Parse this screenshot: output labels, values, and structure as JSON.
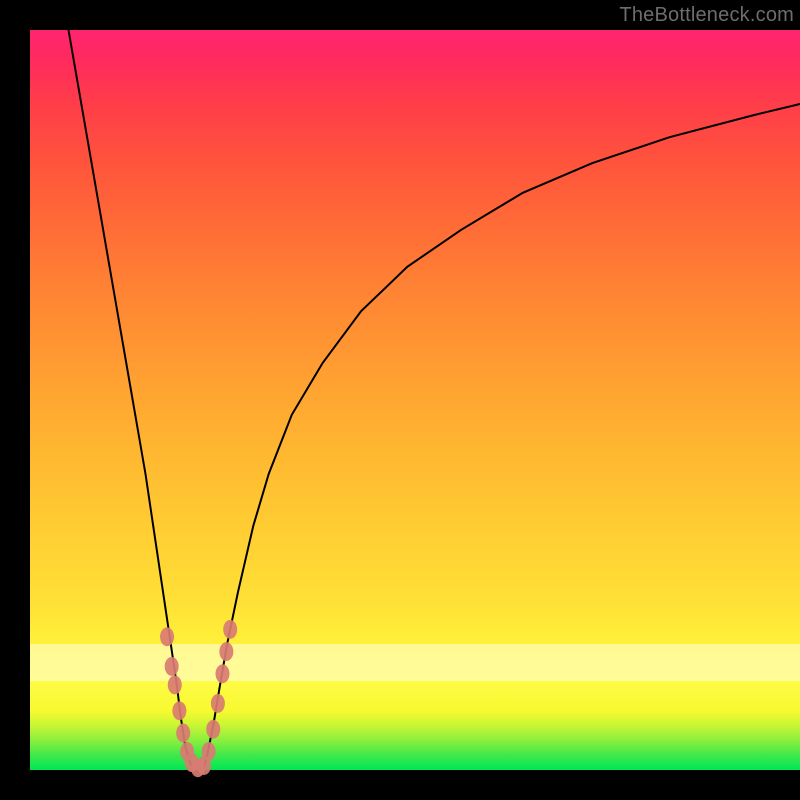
{
  "watermark": "TheBottleneck.com",
  "chart_data": {
    "type": "line",
    "title": "",
    "xlabel": "",
    "ylabel": "",
    "xlim": [
      0,
      100
    ],
    "ylim": [
      0,
      100
    ],
    "grid": false,
    "legend": false,
    "band": {
      "y0": 12,
      "y1": 17,
      "color": "#fffde0",
      "alpha": 0.55
    },
    "series": [
      {
        "name": "left-descent",
        "color": "#000000",
        "x": [
          5,
          7,
          9,
          11,
          13,
          15,
          16,
          17,
          18,
          19,
          19.6,
          20.2,
          20.8,
          21.2
        ],
        "y": [
          100,
          88,
          76,
          64,
          52,
          40,
          33,
          26,
          19,
          12,
          7,
          3,
          1,
          0
        ]
      },
      {
        "name": "right-ascent",
        "color": "#000000",
        "x": [
          22.5,
          23,
          23.8,
          24.6,
          25.6,
          27,
          29,
          31,
          34,
          38,
          43,
          49,
          56,
          64,
          73,
          83,
          94,
          100
        ],
        "y": [
          0,
          2,
          6,
          11,
          17,
          24,
          33,
          40,
          48,
          55,
          62,
          68,
          73,
          78,
          82,
          85.5,
          88.5,
          90
        ]
      }
    ],
    "markers": {
      "color": "#d97b72",
      "radius_px": 7,
      "points": [
        {
          "x": 17.8,
          "y": 18
        },
        {
          "x": 18.4,
          "y": 14
        },
        {
          "x": 18.8,
          "y": 11.5
        },
        {
          "x": 19.4,
          "y": 8
        },
        {
          "x": 19.9,
          "y": 5
        },
        {
          "x": 20.4,
          "y": 2.5
        },
        {
          "x": 21.0,
          "y": 1.0
        },
        {
          "x": 21.8,
          "y": 0.3
        },
        {
          "x": 22.6,
          "y": 0.6
        },
        {
          "x": 23.2,
          "y": 2.5
        },
        {
          "x": 23.8,
          "y": 5.5
        },
        {
          "x": 24.4,
          "y": 9
        },
        {
          "x": 25.0,
          "y": 13
        },
        {
          "x": 25.5,
          "y": 16
        },
        {
          "x": 26.0,
          "y": 19
        }
      ]
    }
  }
}
